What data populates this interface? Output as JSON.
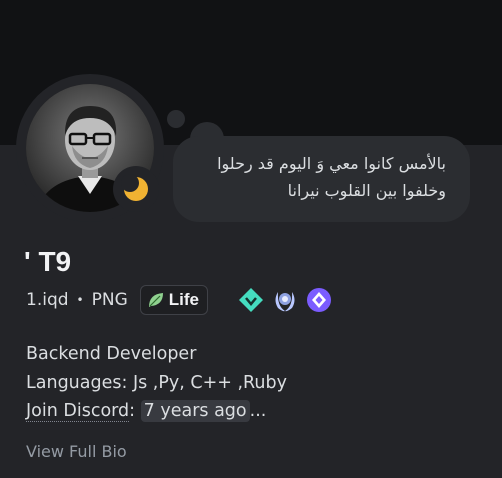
{
  "profile": {
    "display_name": "' T9",
    "status_bubble": {
      "line1": "بالأمس كانوا معي وَ اليوم قد رحلوا",
      "line2": "وخلفوا بين القلوب نيرانا"
    },
    "status_indicator": "idle-moon-icon",
    "username": "1.iqd",
    "separator": "•",
    "pronoun_tag": "PNG",
    "guild_tag": {
      "label": "Life",
      "icon": "leaf-icon"
    },
    "badges": [
      "hypesquad-balance-badge",
      "server-booster-laurel-badge",
      "nitro-badge"
    ],
    "bio": {
      "line1": "Backend Developer",
      "line2": "Languages: Js ,Py, C++ ,Ruby",
      "line3_label": "Join Discord",
      "line3_colon": ":",
      "line3_time": "7 years ago",
      "line3_suffix": "..."
    },
    "view_full_bio": "View Full Bio"
  },
  "colors": {
    "background": "#232428",
    "banner": "#111214",
    "bubble": "#2b2d31",
    "idle": "#f0b232",
    "text": "#dbdee1",
    "muted": "#949ba4"
  }
}
